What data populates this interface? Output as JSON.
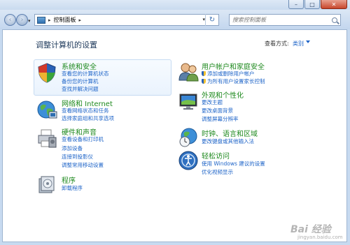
{
  "window": {
    "minimize": "–",
    "maximize": "□",
    "close": "✕"
  },
  "nav": {
    "back_icon": "‹",
    "forward_icon": "›",
    "address_parts": [
      "▸",
      "控制面板",
      "▸"
    ],
    "refresh_icon": "↻",
    "search_placeholder": "搜索控制面板"
  },
  "header": {
    "title": "调整计算机的设置",
    "view_by_label": "查看方式:",
    "view_by_value": "类别"
  },
  "categories": [
    {
      "title": "系统和安全",
      "links": [
        "查看您的计算机状态",
        "备份您的计算机",
        "查找并解决问题"
      ],
      "icon": "shield-icon"
    },
    {
      "title": "网络和 Internet",
      "links": [
        "查看网络状态和任务",
        "选择家庭组和共享选项"
      ],
      "icon": "network-globe-icon"
    },
    {
      "title": "硬件和声音",
      "links": [
        "查看设备和打印机",
        "添加设备",
        "连接到投影仪",
        "调整常用移动设置"
      ],
      "icon": "printer-icon"
    },
    {
      "title": "程序",
      "links": [
        "卸载程序"
      ],
      "icon": "programs-icon"
    },
    {
      "title": "用户帐户和家庭安全",
      "links": [
        "添加或删除用户帐户",
        "为所有用户设置家长控制"
      ],
      "icon": "users-icon"
    },
    {
      "title": "外观和个性化",
      "links": [
        "更改主题",
        "更改桌面背景",
        "调整屏幕分辨率"
      ],
      "icon": "display-icon"
    },
    {
      "title": "时钟、语言和区域",
      "links": [
        "更改键盘或其他输入法"
      ],
      "icon": "clock-globe-icon"
    },
    {
      "title": "轻松访问",
      "links": [
        "使用 Windows 建议的设置",
        "优化视频显示"
      ],
      "icon": "ease-of-access-icon"
    }
  ],
  "watermark": {
    "main": "Bai 经验",
    "sub": "jingyan.baidu.com"
  },
  "colors": {
    "title_green": "#1f8a1f",
    "link_blue": "#1e64c8",
    "frame": "#c7daf0"
  }
}
